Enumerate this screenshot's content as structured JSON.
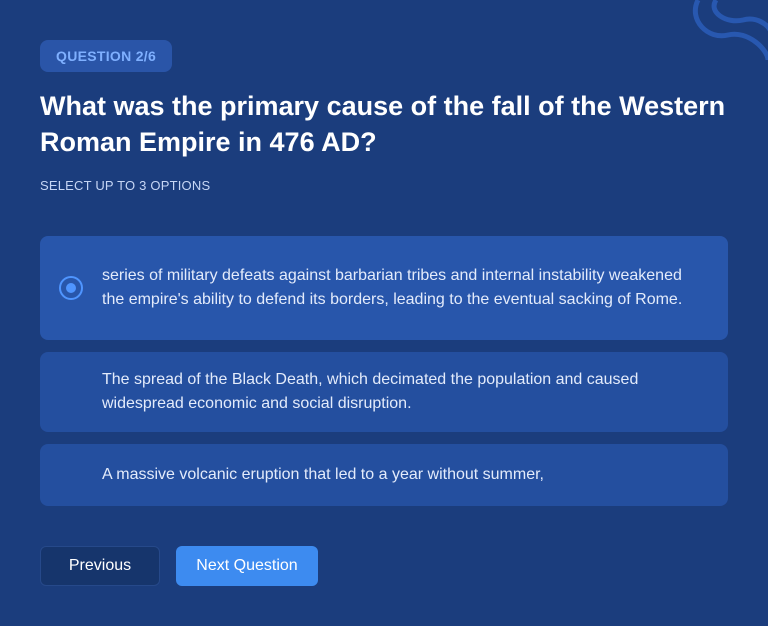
{
  "quiz": {
    "progress_label": "QUESTION 2/6",
    "question": "What was the primary cause of the fall of the Western Roman Empire in 476 AD?",
    "instruction": "SELECT UP TO 3 OPTIONS",
    "options": [
      {
        "text": "series of military defeats against barbarian tribes and internal instability weakened the empire's ability to defend its borders, leading to the eventual sacking of Rome.",
        "selected": true
      },
      {
        "text": "The spread of the Black Death, which decimated the population and caused widespread economic and social disruption.",
        "selected": false
      },
      {
        "text": "A massive volcanic eruption that led to a year without summer,",
        "selected": false
      }
    ]
  },
  "navigation": {
    "previous_label": "Previous",
    "next_label": "Next Question"
  },
  "colors": {
    "background": "#1b3d7d",
    "option_background": "#244f9f",
    "accent": "#3d8bf0",
    "radio": "#4f95ff"
  },
  "icons": {
    "decoration": "wave-line-decoration-icon",
    "selected_option": "radio-selected-icon"
  }
}
